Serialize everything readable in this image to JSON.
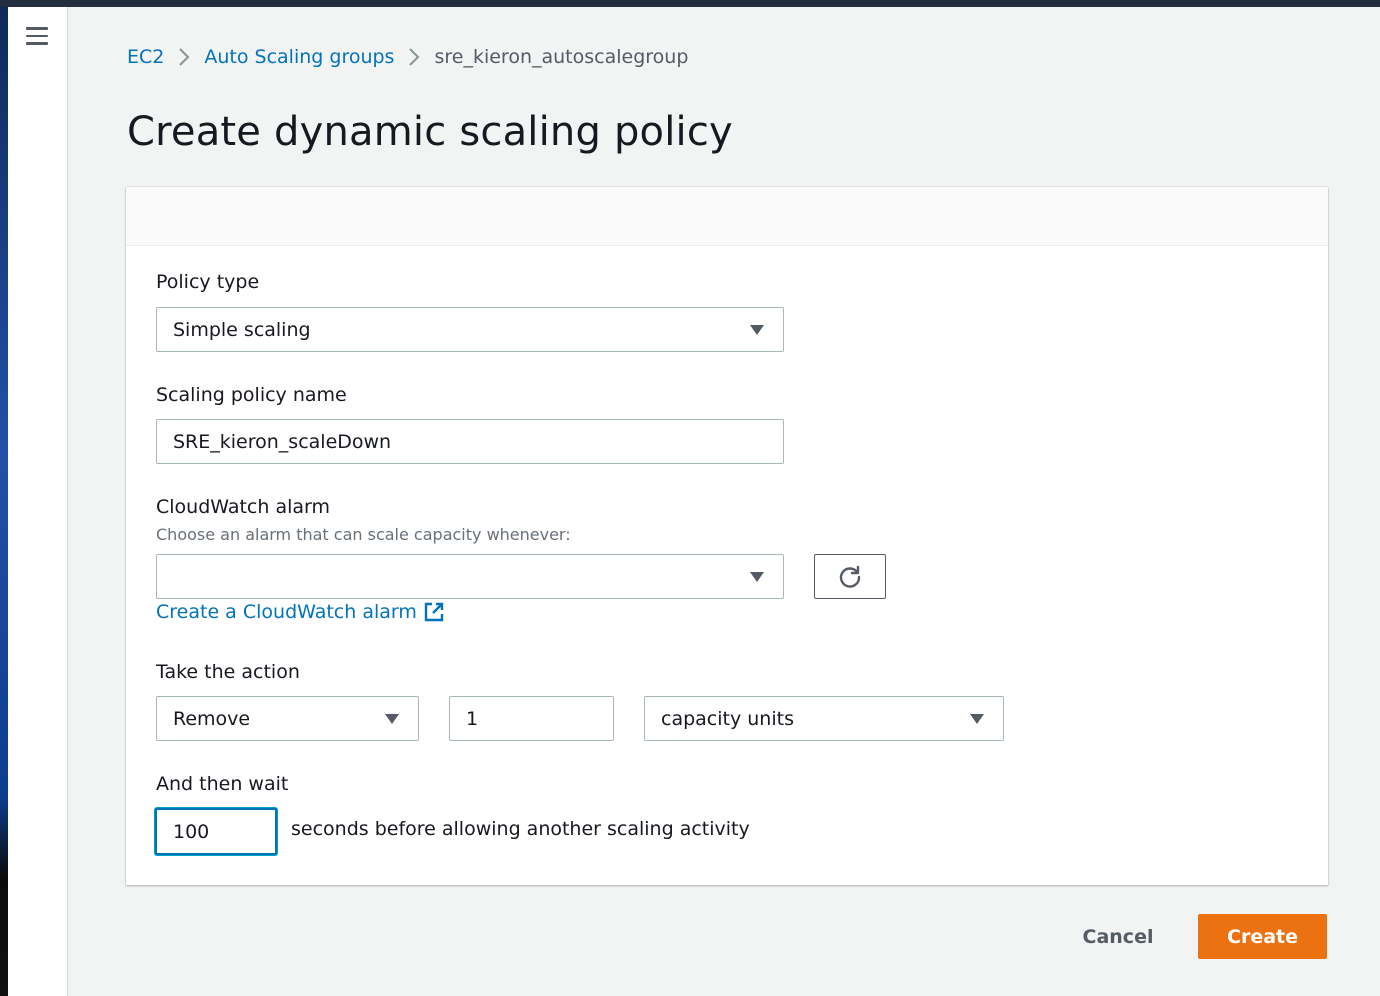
{
  "breadcrumb": {
    "items": [
      "EC2",
      "Auto Scaling groups"
    ],
    "current": "sre_kieron_autoscalegroup"
  },
  "page": {
    "title": "Create dynamic scaling policy"
  },
  "form": {
    "policy_type": {
      "label": "Policy type",
      "value": "Simple scaling"
    },
    "policy_name": {
      "label": "Scaling policy name",
      "value": "SRE_kieron_scaleDown"
    },
    "alarm": {
      "label": "CloudWatch alarm",
      "description": "Choose an alarm that can scale capacity whenever:",
      "value": "",
      "create_link": "Create a CloudWatch alarm"
    },
    "action": {
      "label": "Take the action",
      "operation": "Remove",
      "amount": "1",
      "unit": "capacity units"
    },
    "wait": {
      "label": "And then wait",
      "value": "100",
      "suffix": "seconds before allowing another scaling activity"
    }
  },
  "footer": {
    "cancel_label": "Cancel",
    "create_label": "Create"
  },
  "colors": {
    "accent": "#0073bb",
    "primary_button": "#ec7211",
    "topbar": "#232f3e"
  },
  "icons": [
    "menu-icon",
    "chevron-right-icon",
    "caret-down-icon",
    "refresh-icon",
    "external-link-icon"
  ]
}
